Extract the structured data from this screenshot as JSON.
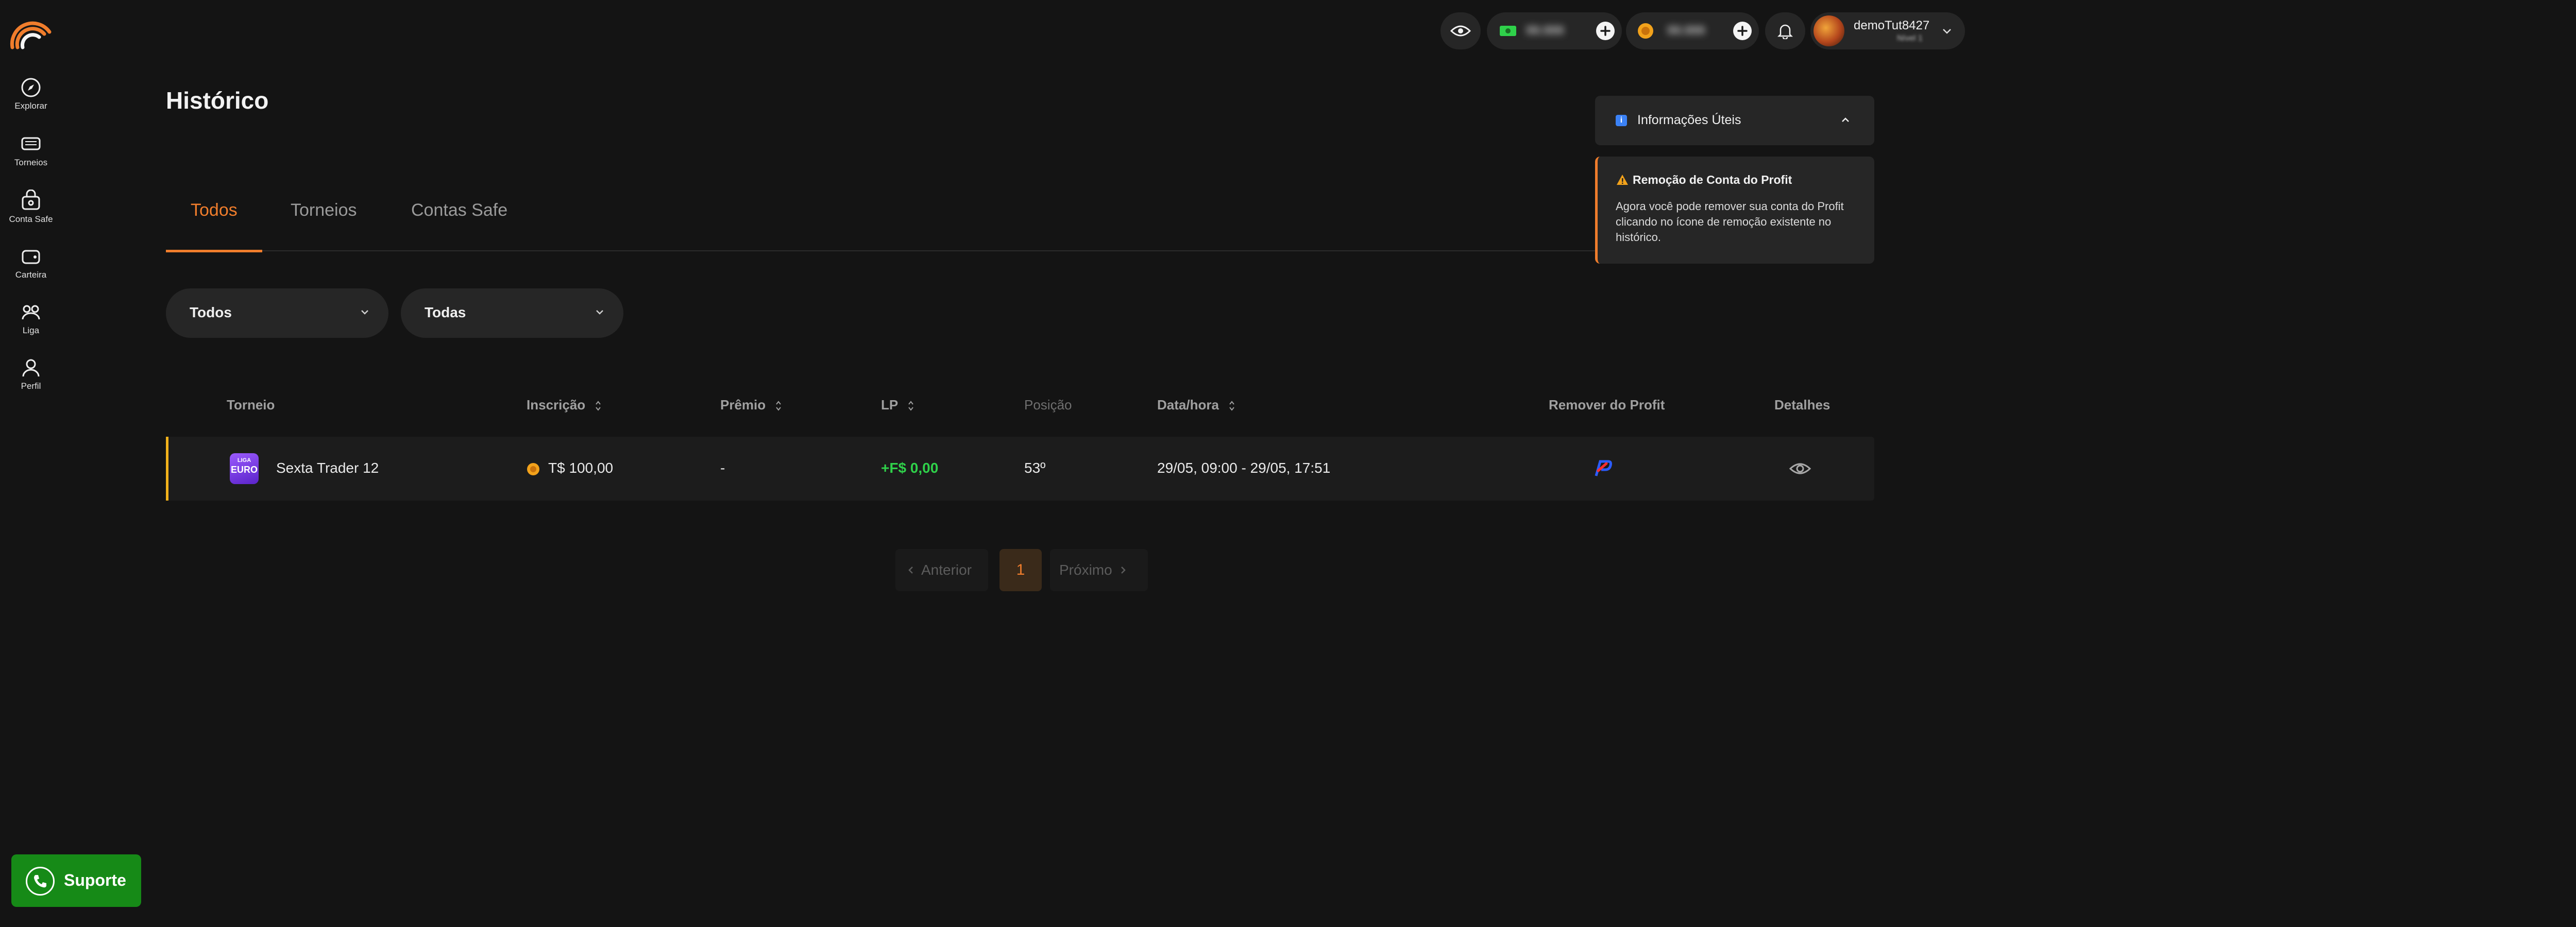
{
  "sidebar": {
    "items": [
      {
        "label": "Explorar",
        "icon": "compass-icon"
      },
      {
        "label": "Torneios",
        "icon": "tournament-icon"
      },
      {
        "label": "Conta Safe",
        "icon": "safe-account-icon"
      },
      {
        "label": "Carteira",
        "icon": "wallet-icon"
      },
      {
        "label": "Liga",
        "icon": "league-icon"
      },
      {
        "label": "Perfil",
        "icon": "user-icon"
      }
    ]
  },
  "topbar": {
    "balance_1": "99.999",
    "balance_2": "99.999",
    "username": "demoTut8427",
    "user_sub": "Nível 1"
  },
  "page": {
    "title": "Histórico"
  },
  "tabs": [
    {
      "label": "Todos",
      "active": true
    },
    {
      "label": "Torneios",
      "active": false
    },
    {
      "label": "Contas Safe",
      "active": false
    }
  ],
  "filters": [
    {
      "value": "Todos"
    },
    {
      "value": "Todas"
    }
  ],
  "table": {
    "headers": {
      "torneio": "Torneio",
      "inscricao": "Inscrição",
      "premio": "Prêmio",
      "lp": "LP",
      "posicao": "Posição",
      "datahora": "Data/hora",
      "remover": "Remover do Profit",
      "detalhes": "Detalhes"
    },
    "rows": [
      {
        "badge_top": "LIGA",
        "badge_main": "EURO",
        "torneio": "Sexta Trader 12",
        "inscricao": "T$ 100,00",
        "premio": "-",
        "lp": "+F$ 0,00",
        "posicao": "53º",
        "datahora": "29/05, 09:00 - 29/05, 17:51"
      }
    ]
  },
  "pagination": {
    "prev": "Anterior",
    "current": "1",
    "next": "Próximo"
  },
  "info": {
    "title": "Informações Úteis",
    "card_title": "Remoção de Conta do Profit",
    "card_lines": [
      "Agora você pode remover sua conta do Profit",
      "clicando no ícone de remoção existente no",
      "histórico."
    ]
  },
  "support": {
    "label": "Suporte"
  },
  "colors": {
    "accent": "#f07d2c",
    "background": "#141414",
    "positive": "#2fd14a",
    "row_marker": "#f2b21b",
    "support": "#168a17"
  }
}
